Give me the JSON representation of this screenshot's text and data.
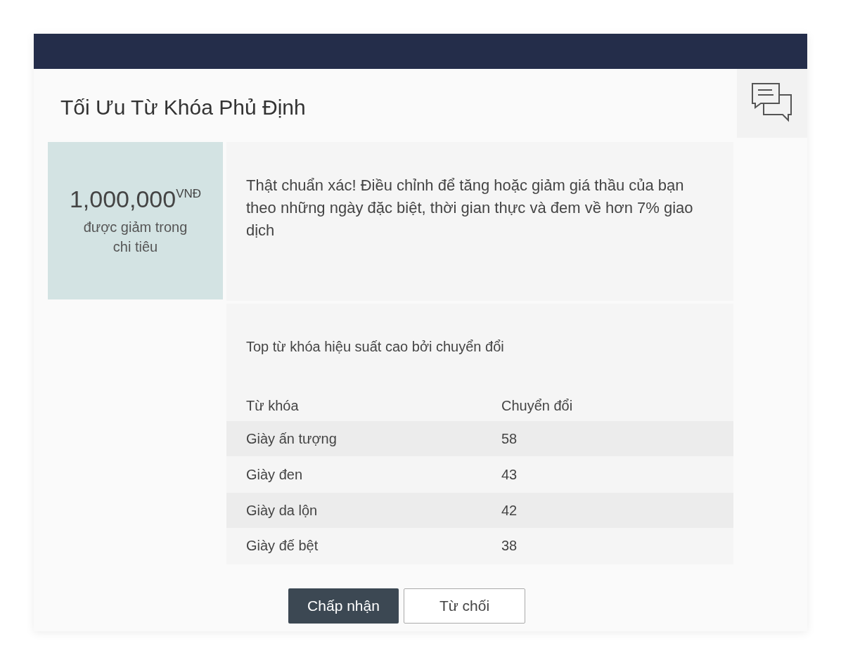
{
  "title": "Tối Ưu Từ Khóa Phủ Định",
  "stat": {
    "amount": "1,000,000",
    "unit": "VNĐ",
    "caption": "được giảm trong chi tiêu"
  },
  "message": "Thật chuẩn xác! Điều chỉnh để tăng hoặc giảm giá thầu của bạn theo những ngày đặc biệt, thời gian thực và đem về hơn 7% giao dịch",
  "table": {
    "title": "Top từ khóa hiệu suất cao bởi chuyển đổi",
    "columns": [
      "Từ khóa",
      "Chuyển đổi"
    ],
    "rows": [
      {
        "keyword": "Giày ấn tượng",
        "conversions": "58"
      },
      {
        "keyword": "Giày đen",
        "conversions": "43"
      },
      {
        "keyword": "Giày da lộn",
        "conversions": "42"
      },
      {
        "keyword": "Giày đế bệt",
        "conversions": "38"
      }
    ]
  },
  "buttons": [
    {
      "label": "Chấp nhận",
      "kind": "primary"
    },
    {
      "label": "Từ chối",
      "kind": "secondary"
    }
  ]
}
